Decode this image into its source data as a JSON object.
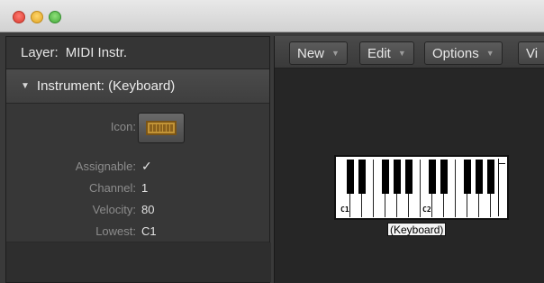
{
  "window": {
    "controls": [
      "close",
      "minimize",
      "zoom"
    ]
  },
  "inspector": {
    "layer_label": "Layer:",
    "layer_value": "MIDI Instr.",
    "section_title": "Instrument: (Keyboard)",
    "icon_label": "Icon:",
    "assignable_label": "Assignable:",
    "assignable_checked": true,
    "channel_label": "Channel:",
    "channel_value": "1",
    "velocity_label": "Velocity:",
    "velocity_value": "80",
    "lowest_label": "Lowest:",
    "lowest_value": "C1"
  },
  "toolbar": {
    "new_label": "New",
    "edit_label": "Edit",
    "options_label": "Options",
    "view_label": "Vi"
  },
  "keyboard_object": {
    "caption": "(Keyboard)",
    "low_label": "C1",
    "high_label": "C2"
  },
  "colors": {
    "accent_check": "#4f8df0",
    "panel_bg": "#2f2f2f",
    "canvas_bg": "#262626"
  }
}
